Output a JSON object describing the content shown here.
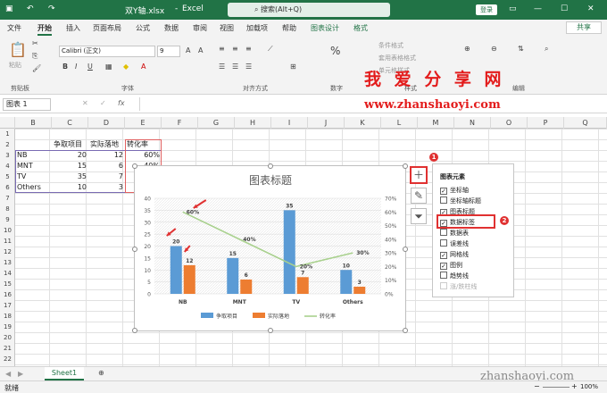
{
  "window": {
    "filename": "双Y轴.xlsx",
    "app": "Excel",
    "search_placeholder": "搜索(Alt+Q)",
    "login": "登录"
  },
  "tabs": [
    "文件",
    "开始",
    "插入",
    "页面布局",
    "公式",
    "数据",
    "审阅",
    "视图",
    "加载项",
    "帮助",
    "图表设计",
    "格式"
  ],
  "share": "共享",
  "ribbon": {
    "font_name": "Calibri (正文)",
    "font_size": "9",
    "groups": [
      "剪贴板",
      "字体",
      "对齐方式",
      "数字",
      "样式",
      "编辑"
    ],
    "paste": "粘贴",
    "cond_format": "条件格式",
    "table_format": "套用表格格式",
    "cell_style": "单元格样式",
    "number_format": "%"
  },
  "watermark": {
    "line1": "我 爱 分 享 网",
    "line2": "www.zhanshaoyi.com",
    "line3": "zhanshaoyi.com"
  },
  "namebox": "图表 1",
  "columns": [
    "B",
    "C",
    "D",
    "E",
    "F",
    "G",
    "H",
    "I",
    "J",
    "K",
    "L",
    "M",
    "N",
    "O",
    "P",
    "Q"
  ],
  "rows": [
    "1",
    "2",
    "3",
    "4",
    "5",
    "6",
    "7",
    "8",
    "9",
    "10",
    "11",
    "12",
    "13",
    "14",
    "15",
    "16",
    "17",
    "18",
    "19",
    "20",
    "21",
    "22"
  ],
  "table": {
    "headers": [
      "争取项目",
      "实际落地",
      "转化率"
    ],
    "rows": [
      [
        "NB",
        "20",
        "12",
        "60%"
      ],
      [
        "MNT",
        "15",
        "6",
        "40%"
      ],
      [
        "TV",
        "35",
        "7",
        "20%"
      ],
      [
        "Others",
        "10",
        "3",
        "30%"
      ]
    ]
  },
  "chart_data": {
    "type": "bar",
    "title": "图表标题",
    "categories": [
      "NB",
      "MNT",
      "TV",
      "Others"
    ],
    "series": [
      {
        "name": "争取项目",
        "type": "bar",
        "color": "#5b9bd5",
        "values": [
          20,
          15,
          35,
          10
        ]
      },
      {
        "name": "实际落地",
        "type": "bar",
        "color": "#ed7d31",
        "values": [
          12,
          6,
          7,
          3
        ]
      },
      {
        "name": "转化率",
        "type": "line",
        "axis": "right",
        "color": "#a9d18e",
        "values": [
          0.6,
          0.4,
          0.2,
          0.3
        ]
      }
    ],
    "ylim": [
      0,
      40
    ],
    "yticks": [
      "40",
      "35",
      "30",
      "25",
      "20",
      "15",
      "10",
      "5",
      "0"
    ],
    "y2lim": [
      0,
      0.7
    ],
    "y2ticks": [
      "70%",
      "60%",
      "50%",
      "40%",
      "30%",
      "20%",
      "10%",
      "0%"
    ],
    "bar_labels": [
      [
        "20",
        "15",
        "35",
        "10"
      ],
      [
        "12",
        "6",
        "7",
        "3"
      ]
    ],
    "line_labels": [
      "60%",
      "40%",
      "20%",
      "30%"
    ],
    "legend": "bottom",
    "grid": true
  },
  "panel": {
    "title": "图表元素",
    "items": [
      {
        "label": "坐标轴",
        "checked": true
      },
      {
        "label": "坐标轴标题",
        "checked": false
      },
      {
        "label": "图表标题",
        "checked": true
      },
      {
        "label": "数据标签",
        "checked": true
      },
      {
        "label": "数据表",
        "checked": false
      },
      {
        "label": "误差线",
        "checked": false
      },
      {
        "label": "网格线",
        "checked": true
      },
      {
        "label": "图例",
        "checked": true
      },
      {
        "label": "趋势线",
        "checked": false
      },
      {
        "label": "涨/跌柱线",
        "checked": false
      }
    ]
  },
  "markers": [
    "1",
    "2"
  ],
  "sheet": "Sheet1",
  "status": {
    "left": "就绪",
    "zoom": "100%"
  }
}
